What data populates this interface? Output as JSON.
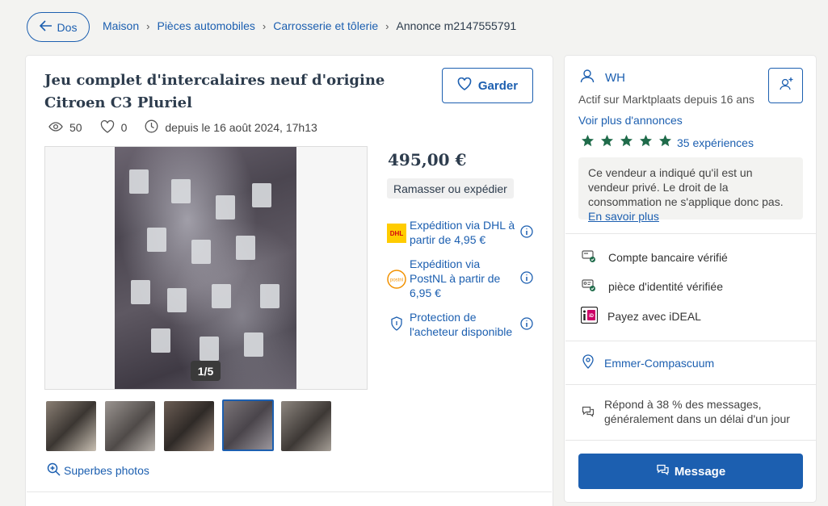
{
  "nav": {
    "back_label": "Dos",
    "breadcrumbs": [
      "Maison",
      "Pièces automobiles",
      "Carrosserie et tôlerie"
    ],
    "current": "Annonce m2147555791"
  },
  "listing": {
    "title": "Jeu complet d'intercalaires neuf d'origine Citroen C3 Pluriel",
    "save_label": "Garder",
    "views": "50",
    "favorites": "0",
    "posted": "depuis le 16 août 2024, 17h13",
    "photo_counter": "1/5",
    "superbes_label": "Superbes photos",
    "price": "495,00 €",
    "delivery_badge": "Ramasser ou expédier",
    "shipping_options": [
      {
        "label": "Expédition via DHL à partir de 4,95 €",
        "icon": "dhl-logo-icon"
      },
      {
        "label": "Expédition via PostNL à partir de 6,95 €",
        "icon": "postnl-logo-icon"
      },
      {
        "label": "Protection de l'acheteur disponible",
        "icon": "shield-icon"
      }
    ],
    "dhl_logo_text": "DHL",
    "postnl_logo_text": "postnl"
  },
  "seller": {
    "name": "WH",
    "active_since": "Actif sur Marktplaats depuis 16 ans",
    "more_ads": "Voir plus d'annonces",
    "rating_stars": 5,
    "experiences": "35 expériences",
    "notice": "Ce vendeur a indiqué qu'il est un vendeur privé. Le droit de la consommation ne s'applique donc pas.",
    "notice_link": "En savoir plus",
    "verifications": [
      {
        "label": "Compte bancaire vérifié",
        "icon": "bank-check-icon"
      },
      {
        "label": "pièce d'identité vérifiée",
        "icon": "id-check-icon"
      },
      {
        "label": "Payez avec iDEAL",
        "icon": "ideal-icon"
      }
    ],
    "ideal_logo_text": "iD",
    "location": "Emmer-Compascuum",
    "response": "Répond à 38 % des messages, généralement dans un délai d'un jour",
    "message_label": "Message"
  },
  "colors": {
    "accent": "#1c5fb0",
    "star": "#1f6b4a",
    "text": "#2d3c4d"
  }
}
